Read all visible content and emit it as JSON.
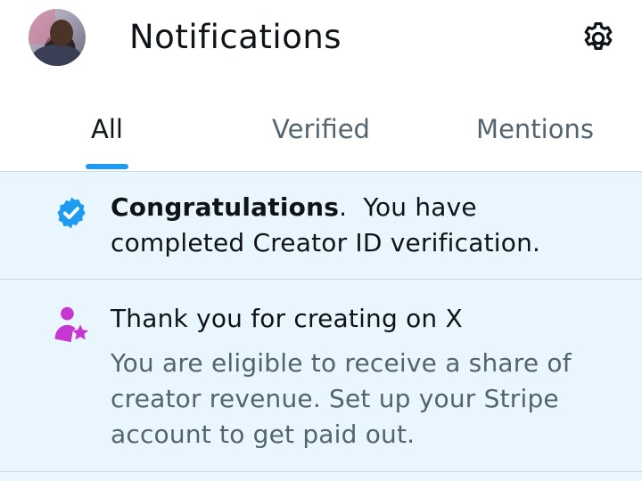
{
  "header": {
    "title": "Notifications",
    "avatar_icon": "user-avatar",
    "settings_icon": "gear-icon"
  },
  "tabs": [
    {
      "label": "All",
      "active": true
    },
    {
      "label": "Verified",
      "active": false
    },
    {
      "label": "Mentions",
      "active": false
    }
  ],
  "notifications": [
    {
      "icon": "verified-badge-icon",
      "bold_text": "Congratulations",
      "text": ".  You have completed Creator ID verification."
    },
    {
      "icon": "creator-person-star-icon",
      "title": "Thank you for creating on X",
      "body": "You are eligible to receive a share of creator revenue. Set up your Stripe account to get paid out."
    }
  ],
  "colors": {
    "accent": "#1d9bf0",
    "highlight_bg": "#eaf6fd",
    "creator_icon": "#c736d1",
    "muted_text": "#536471"
  }
}
